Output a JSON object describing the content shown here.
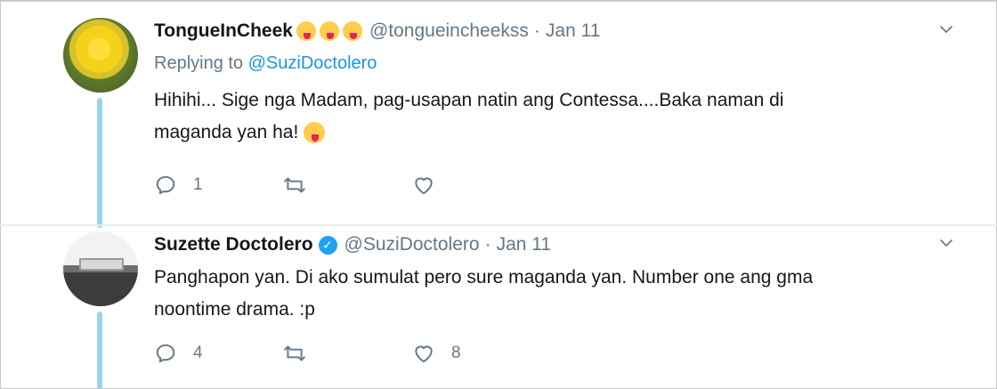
{
  "tweets": [
    {
      "display_name": "TongueInCheek",
      "handle": "@tongueincheekss",
      "separator": "·",
      "date": "Jan 11",
      "replying_prefix": "Replying to",
      "replying_to": "@SuziDoctolero",
      "text_line1": "Hihihi... Sige nga Madam, pag-usapan natin ang Contessa....Baka naman di",
      "text_line2": "maganda yan ha!",
      "reply_count": "1",
      "retweet_count": "",
      "like_count": ""
    },
    {
      "display_name": "Suzette Doctolero",
      "verified_mark": "✓",
      "handle": "@SuziDoctolero",
      "separator": "·",
      "date": "Jan 11",
      "text_line1": "Panghapon yan. Di ako sumulat pero sure maganda yan.  Number one ang gma",
      "text_line2": "noontime drama. :p",
      "reply_count": "4",
      "retweet_count": "",
      "like_count": "8"
    }
  ],
  "colors": {
    "thread_line": "#9ad3ef",
    "mention": "#1b95e0",
    "secondary_text": "#657786",
    "verified": "#1da1f2"
  },
  "icons": [
    "reply-icon",
    "retweet-icon",
    "like-icon",
    "chevron-down-icon",
    "verified-icon",
    "emoji-icon"
  ]
}
